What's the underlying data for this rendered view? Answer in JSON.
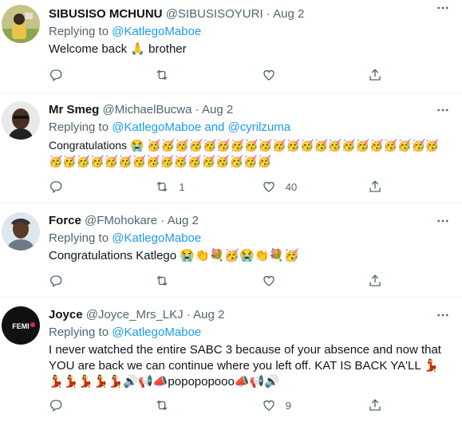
{
  "tweets": [
    {
      "name": "SIBUSISO MCHUNU",
      "handle": "@SIBUSISOYURI",
      "date": "Aug 2",
      "replying_prefix": "Replying to",
      "mentions": "@KatlegoMaboe",
      "text": "Welcome back 🙏 brother",
      "reply_count": "",
      "retweet_count": "",
      "like_count": ""
    },
    {
      "name": "Mr Smeg",
      "handle": "@MichaelBucwa",
      "date": "Aug 2",
      "replying_prefix": "Replying to",
      "mentions": "@KatlegoMaboe and @cyrilzuma",
      "text": "Congratulations 😭 🥳🥳🥳🥳🥳🥳🥳🥳🥳🥳🥳🥳🥳🥳🥳🥳🥳🥳🥳🥳🥳🥳🥳🥳🥳🥳🥳🥳🥳🥳🥳🥳🥳🥳🥳🥳🥳",
      "reply_count": "",
      "retweet_count": "1",
      "like_count": "40"
    },
    {
      "name": "Force",
      "handle": "@FMohokare",
      "date": "Aug 2",
      "replying_prefix": "Replying to",
      "mentions": "@KatlegoMaboe",
      "text": "Congratulations Katlego 😭👏💐🥳😭👏💐🥳",
      "reply_count": "",
      "retweet_count": "",
      "like_count": ""
    },
    {
      "name": "Joyce",
      "handle": "@Joyce_Mrs_LKJ",
      "date": "Aug 2",
      "replying_prefix": "Replying to",
      "mentions": "@KatlegoMaboe",
      "avatar_text": "FEMI",
      "text": "I never watched the entire SABC 3 because of your absence and now that YOU are back we can continue where you left off. KAT IS BACK YA'LL 💃💃💃💃💃💃🔊📢📣popopopooo📣📢🔊",
      "reply_count": "",
      "retweet_count": "",
      "like_count": "9"
    }
  ],
  "colors": {
    "link": "#1d9bf0",
    "muted": "#536471",
    "text": "#0f1419",
    "divider": "#eff3f4"
  },
  "icons": [
    "reply-icon",
    "retweet-icon",
    "like-icon",
    "share-icon",
    "more-icon"
  ]
}
